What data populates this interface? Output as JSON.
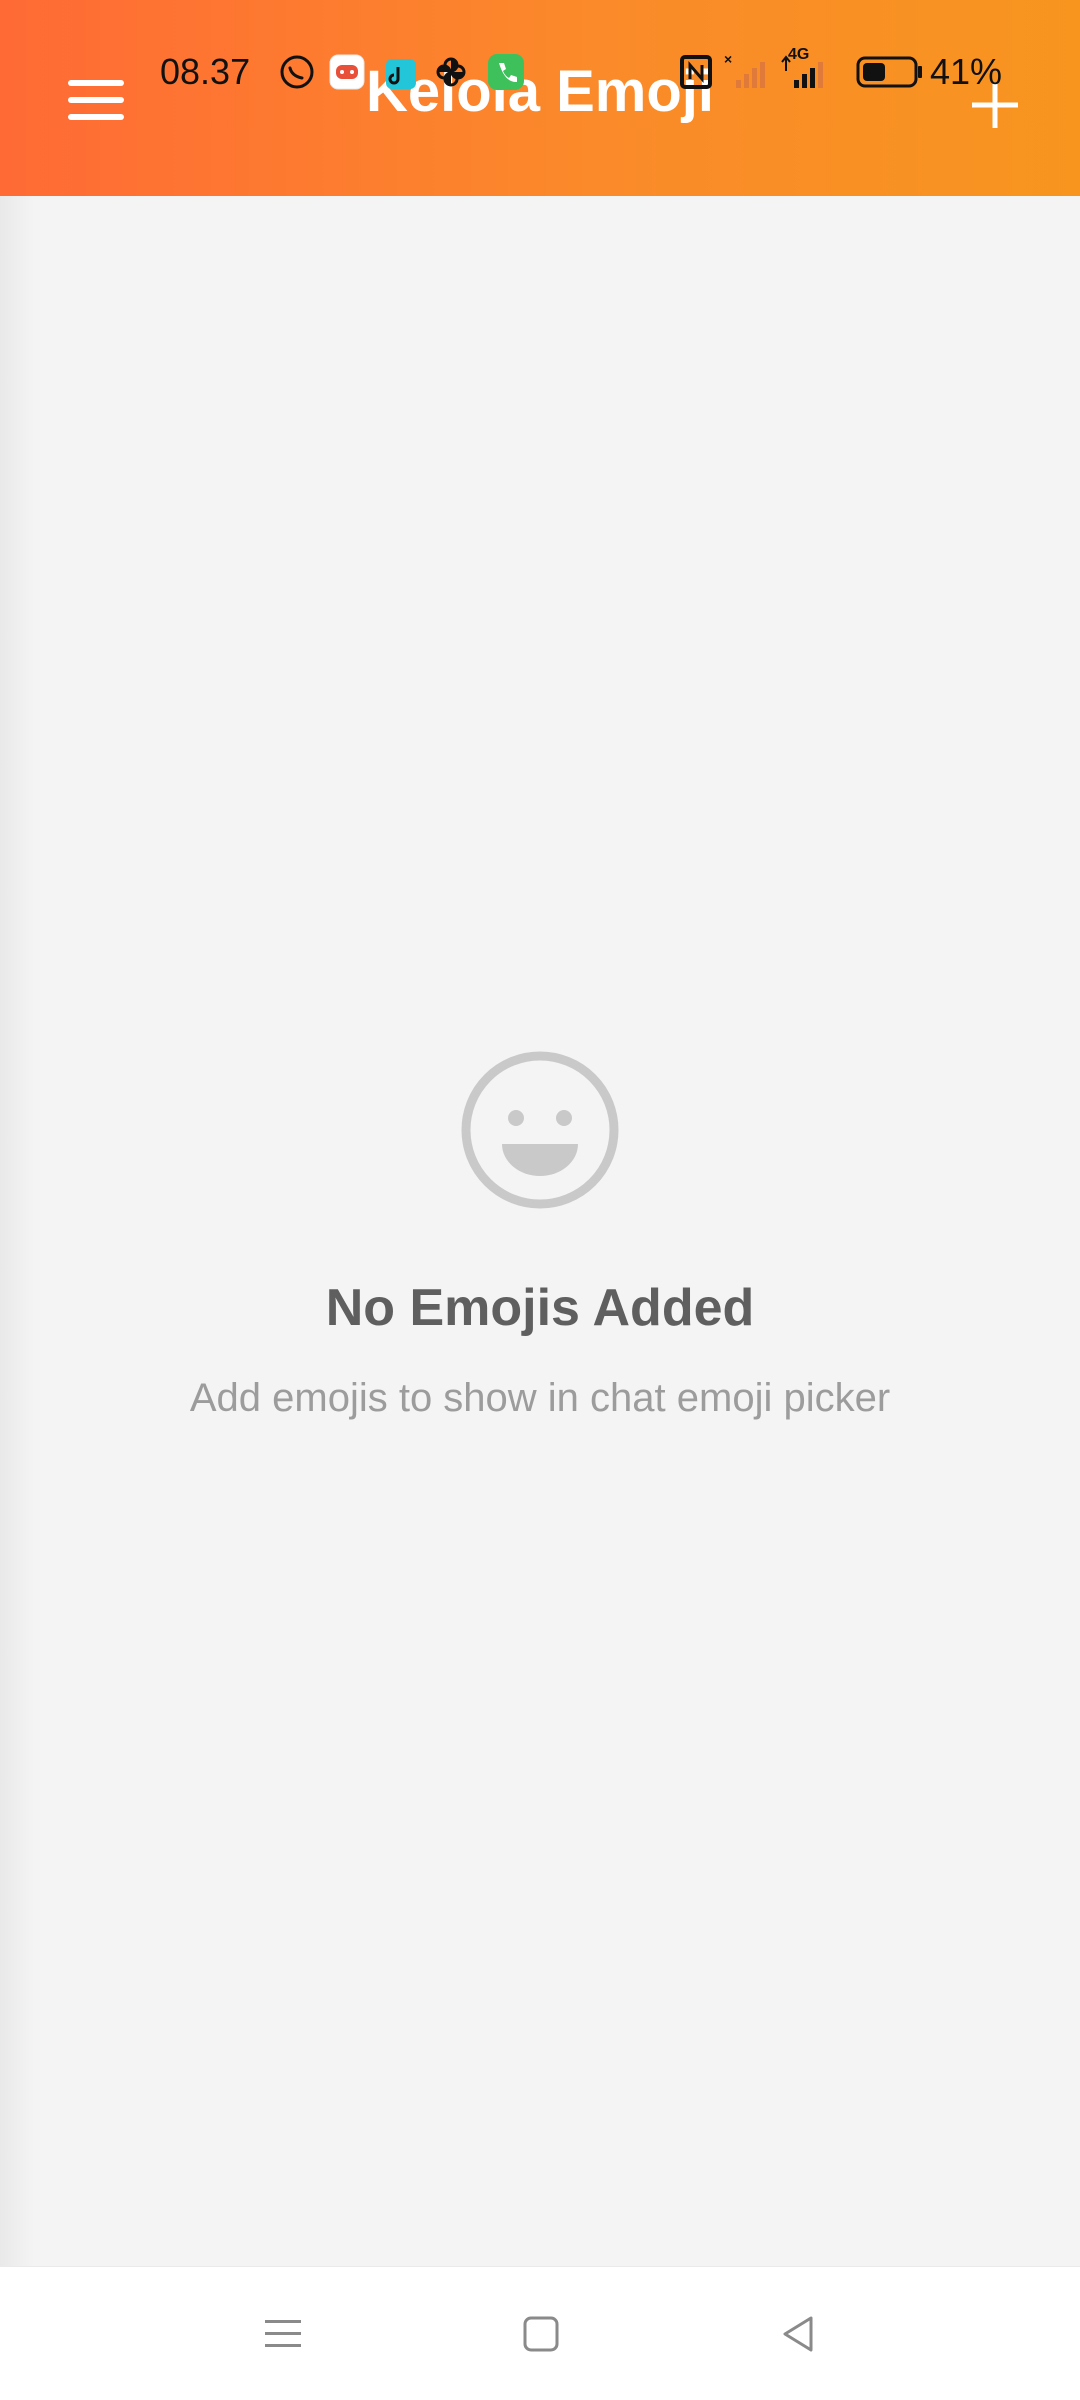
{
  "status_bar": {
    "time": "08.37",
    "battery_percent": "41%",
    "network_label": "4G",
    "icons": [
      "whatsapp-icon",
      "game-icon",
      "tiktok-icon",
      "pinwheel-icon",
      "phone-icon",
      "nfc-icon",
      "signal-icon",
      "signal-icon",
      "battery-icon"
    ]
  },
  "app_bar": {
    "title": "Keloia Emoji",
    "menu_icon": "hamburger-menu-icon",
    "add_icon": "plus-icon",
    "colors": {
      "gradient_start": "#ff6a35",
      "gradient_end": "#f7951f"
    }
  },
  "empty_state": {
    "icon": "smiley-face-icon",
    "title": "No Emojis Added",
    "subtitle": "Add emojis to show in chat emoji picker"
  },
  "nav_bar": {
    "buttons": [
      "recents-icon",
      "home-icon",
      "back-icon"
    ]
  }
}
